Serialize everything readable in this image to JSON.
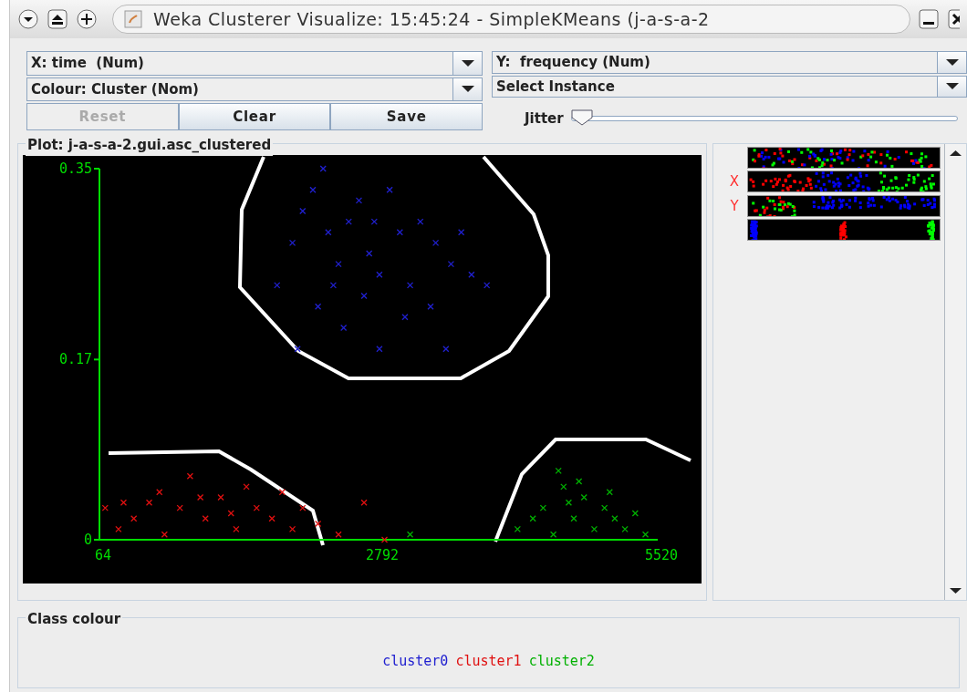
{
  "window": {
    "title": "Weka Clusterer Visualize: 15:45:24 - SimpleKMeans (j-a-s-a-2"
  },
  "x_axis_select": {
    "value": "X: time  (Num)"
  },
  "y_axis_select": {
    "value": "Y:  frequency (Num)"
  },
  "colour_select": {
    "value": "Colour: Cluster (Nom)"
  },
  "instance_select": {
    "value": "Select Instance"
  },
  "buttons": [
    {
      "label": "Reset",
      "disabled": true
    },
    {
      "label": "Clear",
      "disabled": false
    },
    {
      "label": "Save",
      "disabled": false
    }
  ],
  "jitter": {
    "label": "Jitter",
    "level": 0
  },
  "plot": {
    "title": "Plot: j-a-s-a-2.gui.asc_clustered",
    "chart_data": {
      "type": "scatter",
      "xlim": [
        64,
        5520
      ],
      "ylim": [
        0,
        0.35
      ],
      "xticks": [
        64,
        2792,
        5520
      ],
      "yticks": [
        0,
        0.17,
        0.35
      ],
      "series": [
        {
          "name": "cluster0",
          "color": "#2020d0",
          "x": [
            1800,
            1950,
            2050,
            2150,
            2250,
            2300,
            2400,
            2500,
            2600,
            2700,
            2800,
            2900,
            3000,
            3100,
            3200,
            3350,
            3500,
            3700,
            3850,
            2200,
            2450,
            2800,
            3450,
            2000,
            2650,
            3050,
            3300,
            2350,
            2750,
            3600
          ],
          "values": [
            0.24,
            0.28,
            0.31,
            0.33,
            0.35,
            0.29,
            0.26,
            0.3,
            0.32,
            0.27,
            0.25,
            0.33,
            0.29,
            0.24,
            0.3,
            0.28,
            0.26,
            0.25,
            0.24,
            0.22,
            0.2,
            0.18,
            0.18,
            0.18,
            0.23,
            0.21,
            0.22,
            0.24,
            0.3,
            0.29
          ]
        },
        {
          "name": "cluster1",
          "color": "#e01010",
          "x": [
            120,
            250,
            400,
            550,
            700,
            850,
            950,
            1100,
            1250,
            1400,
            1500,
            1600,
            1750,
            1850,
            1950,
            2050,
            2200,
            2400,
            2650,
            2850,
            300,
            650,
            1050,
            1350
          ],
          "values": [
            0.03,
            0.01,
            0.02,
            0.035,
            0.005,
            0.03,
            0.06,
            0.02,
            0.04,
            0.01,
            0.05,
            0.03,
            0.02,
            0.045,
            0.01,
            0.03,
            0.015,
            0.005,
            0.035,
            0.0,
            0.035,
            0.045,
            0.04,
            0.025
          ]
        },
        {
          "name": "cluster2",
          "color": "#00b000",
          "x": [
            3100,
            4150,
            4300,
            4400,
            4500,
            4600,
            4700,
            4800,
            4900,
            5000,
            5100,
            5200,
            5300,
            5400,
            4550,
            4750,
            4650,
            5050
          ],
          "values": [
            0.005,
            0.01,
            0.02,
            0.03,
            0.005,
            0.05,
            0.02,
            0.04,
            0.01,
            0.03,
            0.02,
            0.01,
            0.025,
            0.005,
            0.065,
            0.055,
            0.035,
            0.045
          ]
        }
      ]
    }
  },
  "attribute_bars": [
    {
      "kind": "mixed"
    },
    {
      "kind": "spread",
      "marker": "X"
    },
    {
      "kind": "ybands",
      "marker": "Y"
    },
    {
      "kind": "grouped"
    }
  ],
  "class_colour": {
    "title": "Class colour"
  }
}
